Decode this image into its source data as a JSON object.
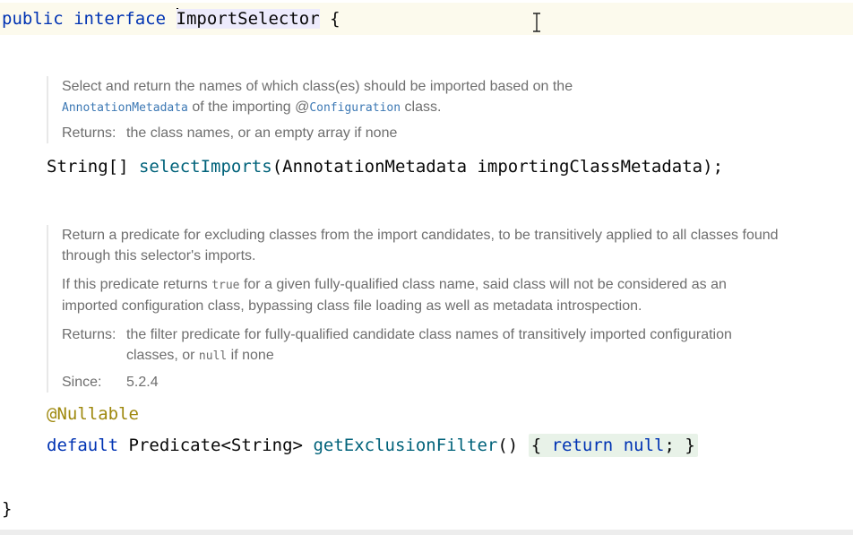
{
  "header": {
    "kw_public": "public",
    "kw_interface": "interface",
    "type_name": "ImportSelector",
    "brace_open": "{"
  },
  "doc1": {
    "line1": "Select and return the names of which class(es) should be imported based on the",
    "link1": "AnnotationMetadata",
    "mid1": " of the importing @",
    "link2": "Configuration",
    "end1": " class.",
    "returns_label": "Returns:",
    "returns_text": "the class names, or an empty array if none"
  },
  "method1": {
    "return_type": "String[]",
    "name": "selectImports",
    "params": "(AnnotationMetadata importingClassMetadata);"
  },
  "doc2": {
    "para1": "Return a predicate for excluding classes from the import candidates, to be transitively applied to all classes found through this selector's imports.",
    "para2_a": "If this predicate returns ",
    "para2_code": "true",
    "para2_b": " for a given fully-qualified class name, said class will not be considered as an imported configuration class, bypassing class file loading as well as metadata introspection.",
    "returns_label": "Returns:",
    "returns_a": "the filter predicate for fully-qualified candidate class names of transitively imported configuration classes, or ",
    "returns_code": "null",
    "returns_b": " if none",
    "since_label": "Since:",
    "since_value": "5.2.4"
  },
  "method2": {
    "annotation": "@Nullable",
    "kw_default": "default",
    "return_type": "Predicate<String>",
    "name": "getExclusionFilter",
    "parens": "()",
    "body_open": "{",
    "kw_return": "return",
    "kw_null": "null",
    "semicolon": ";",
    "body_close": "}"
  },
  "footer": {
    "brace_close": "}"
  }
}
